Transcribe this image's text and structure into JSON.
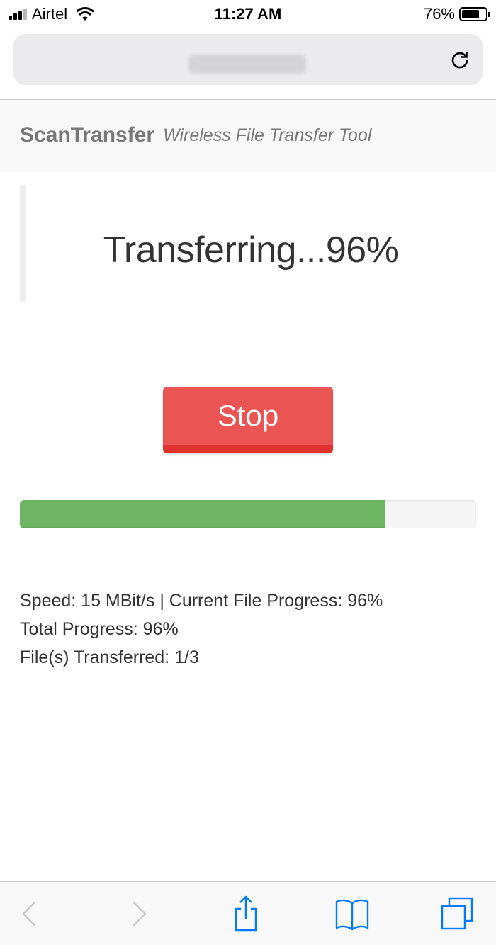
{
  "status_bar": {
    "carrier": "Airtel",
    "time": "11:27 AM",
    "battery_percent": "76%",
    "battery_level": 0.76,
    "signal_bars_active": 3,
    "signal_bars_total": 4
  },
  "header": {
    "brand": "ScanTransfer",
    "tagline": "Wireless File Transfer Tool"
  },
  "transfer": {
    "headline": "Transferring...96%",
    "stop_label": "Stop",
    "progress_fraction": 0.8,
    "speed_line": "Speed: 15 MBit/s | Current File Progress: 96%",
    "total_line": "Total Progress: 96%",
    "files_line": "File(s) Transferred: 1/3"
  },
  "toolbar": {
    "icons": [
      "back-icon",
      "forward-icon",
      "share-icon",
      "bookmarks-icon",
      "tabs-icon"
    ]
  },
  "colors": {
    "stop": "#ea5452",
    "progress": "#6db463",
    "ios_blue": "#007aff"
  }
}
